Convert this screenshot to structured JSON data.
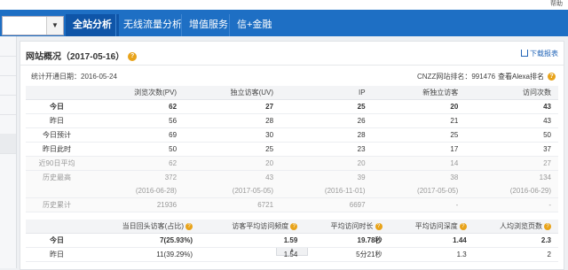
{
  "top_corner": "帮助",
  "nav": {
    "tabs": [
      "全站分析",
      "无线流量分析",
      "增值服务",
      "信+金融"
    ]
  },
  "panel": {
    "title": "网站概况（2017-05-16）",
    "download_label": "下载报表",
    "stat_since": "统计开通日期：2016-05-24",
    "cnzz_rank": "CNZZ网站排名：991476",
    "alexa_rank": "查看Alexa排名"
  },
  "overview_table": {
    "headers": [
      "",
      "浏览次数(PV)",
      "独立访客(UV)",
      "IP",
      "新独立访客",
      "访问次数"
    ],
    "rows": [
      {
        "label": "今日",
        "cells": [
          "62",
          "27",
          "25",
          "20",
          "43"
        ]
      },
      {
        "label": "昨日",
        "cells": [
          "56",
          "28",
          "26",
          "21",
          "43"
        ]
      },
      {
        "label": "今日预计",
        "cells": [
          "69",
          "30",
          "28",
          "25",
          "50"
        ]
      },
      {
        "label": "昨日此时",
        "cells": [
          "50",
          "25",
          "23",
          "17",
          "37"
        ]
      },
      {
        "label": "近90日平均",
        "cells": [
          "62",
          "20",
          "20",
          "14",
          "27"
        ]
      },
      {
        "label": "历史最高",
        "cells": [
          "372",
          "43",
          "39",
          "38",
          "134"
        ]
      },
      {
        "label": "",
        "cells": [
          "(2016-06-28)",
          "(2017-05-05)",
          "(2016-11-01)",
          "(2017-05-05)",
          "(2016-06-29)"
        ]
      },
      {
        "label": "历史累计",
        "cells": [
          "21936",
          "6721",
          "6697",
          "-",
          "-"
        ]
      }
    ]
  },
  "collapse_label": "▲",
  "detail_table": {
    "headers": [
      "",
      "当日回头访客(占比)",
      "访客平均访问频度",
      "平均访问时长",
      "平均访问深度",
      "人均浏览页数"
    ],
    "rows": [
      {
        "label": "今日",
        "cells": [
          "7(25.93%)",
          "1.59",
          "19.78秒",
          "1.44",
          "2.3"
        ]
      },
      {
        "label": "昨日",
        "cells": [
          "11(39.29%)",
          "1.54",
          "5分21秒",
          "1.3",
          "2"
        ]
      }
    ]
  },
  "colors": {
    "nav_bg": "#1e6fc4",
    "nav_active": "#0f55a8",
    "help_icon": "#e8a31a",
    "link": "#2466b8"
  }
}
